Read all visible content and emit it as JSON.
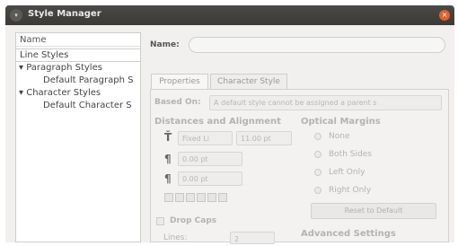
{
  "window": {
    "title": "Style Manager",
    "menu_glyph": "▾",
    "close_glyph": "×"
  },
  "tree": {
    "header": "Name",
    "items": [
      {
        "label": "Line Styles",
        "indent": 0,
        "expander": ""
      },
      {
        "label": "Paragraph Styles",
        "indent": 0,
        "expander": "▾"
      },
      {
        "label": "Default Paragraph S",
        "indent": 1,
        "expander": ""
      },
      {
        "label": "Character Styles",
        "indent": 0,
        "expander": "▾"
      },
      {
        "label": "Default Character S",
        "indent": 1,
        "expander": ""
      }
    ],
    "selected_index": 0
  },
  "name_label": "Name:",
  "name_value": "",
  "tabs": [
    {
      "label": "Properties",
      "active": true
    },
    {
      "label": "Character Style",
      "active": false
    }
  ],
  "based_on": {
    "label": "Based On:",
    "value": "A default style cannot be assigned a parent s"
  },
  "distances": {
    "heading": "Distances and Alignment",
    "line_spacing_mode": "Fixed Li",
    "line_spacing_value": "11.00 pt",
    "space_above": "0.00 pt",
    "space_below": "0.00 pt"
  },
  "optical_margins": {
    "heading": "Optical Margins",
    "options": [
      "None",
      "Both Sides",
      "Left Only",
      "Right Only"
    ],
    "reset_label": "Reset to Default"
  },
  "drop_caps": {
    "label": "Drop Caps",
    "lines_label": "Lines:",
    "lines_value": "2"
  },
  "advanced": {
    "heading": "Advanced Settings"
  },
  "icons": {
    "line_spacing": "Ť",
    "space_above": "¶",
    "space_below": "¶"
  }
}
